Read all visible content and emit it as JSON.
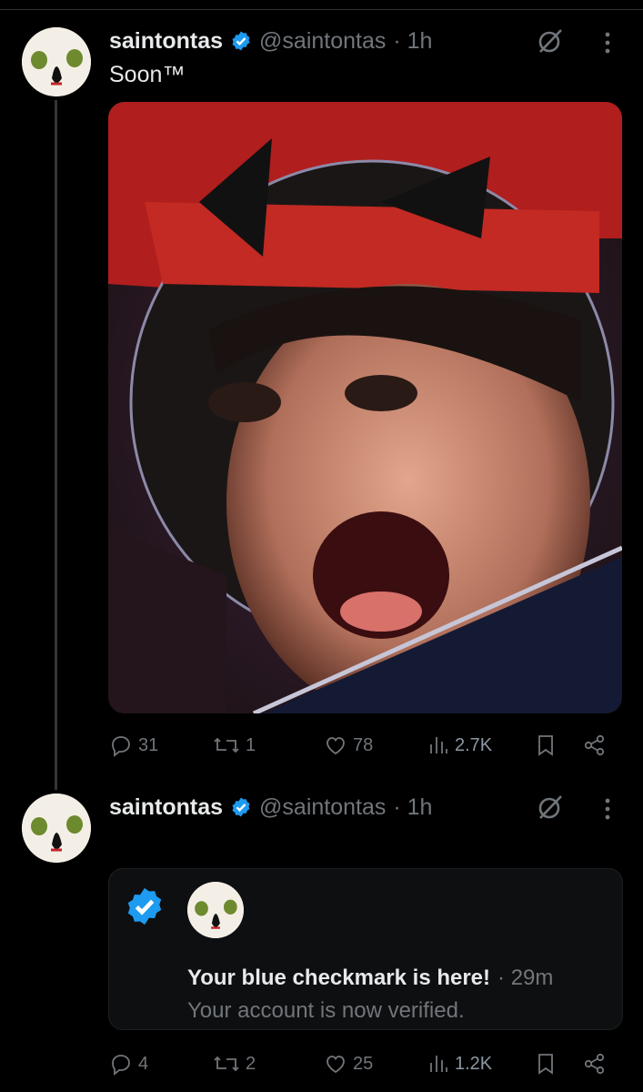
{
  "tweets": [
    {
      "display_name": "saintontas",
      "handle": "@saintontas",
      "time": "· 1h",
      "text": "Soon™",
      "stats": {
        "replies": "31",
        "reposts": "1",
        "likes": "78",
        "views": "2.7K"
      }
    },
    {
      "display_name": "saintontas",
      "handle": "@saintontas",
      "time": "· 1h",
      "card": {
        "title": "Your blue checkmark is here!",
        "time": "· 29m",
        "subtitle": "Your account is now verified."
      },
      "stats": {
        "replies": "4",
        "reposts": "2",
        "likes": "25",
        "views": "1.2K"
      }
    }
  ],
  "colors": {
    "verified_blue": "#1d9bf0",
    "background": "#000000",
    "muted": "#71767b"
  },
  "icons": [
    "verified-badge-icon",
    "grok-icon",
    "more-icon",
    "reply-icon",
    "repost-icon",
    "like-icon",
    "views-icon",
    "bookmark-icon",
    "share-icon"
  ]
}
